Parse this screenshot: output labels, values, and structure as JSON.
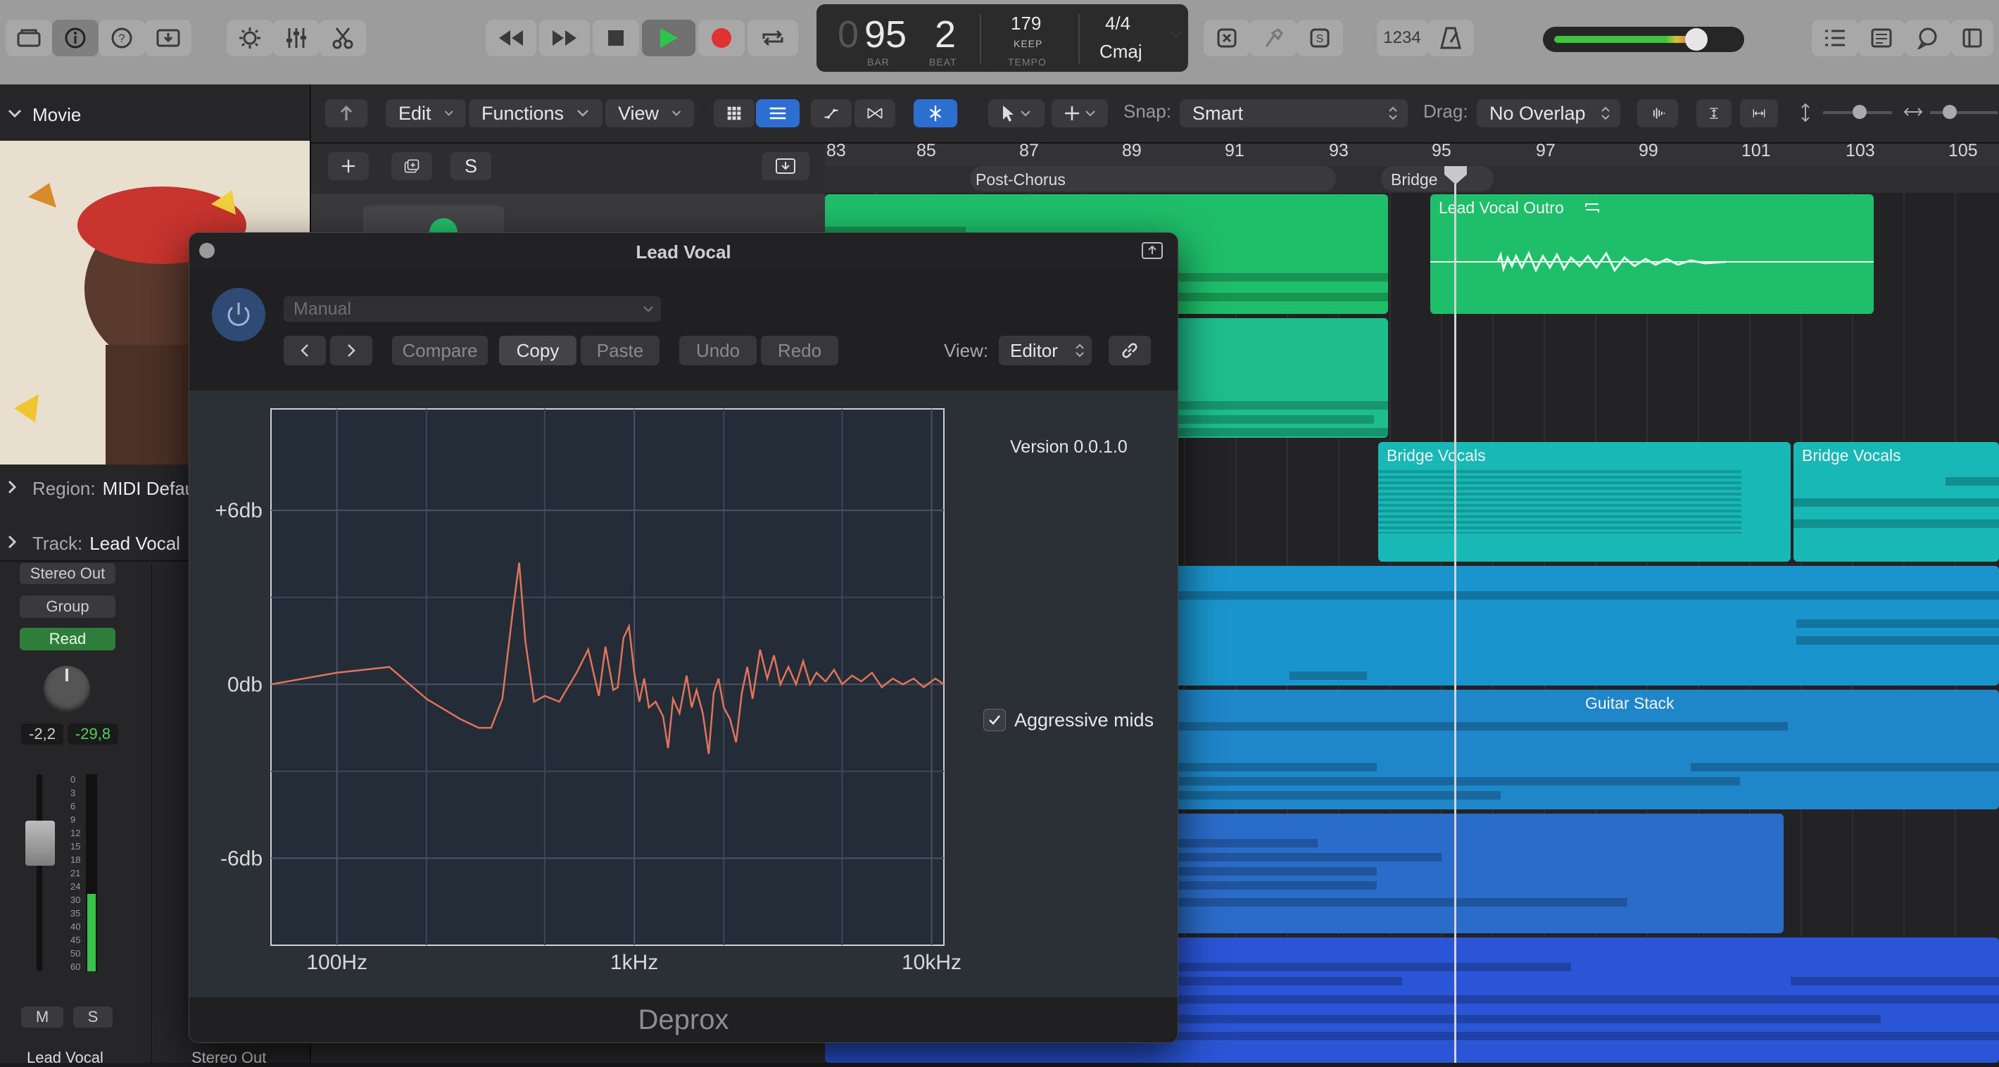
{
  "transport": {
    "bar": "95",
    "beat": "2",
    "bar_label": "BAR",
    "beat_label": "BEAT",
    "tempo": "179",
    "tempo_mode": "KEEP",
    "tempo_label": "TEMPO",
    "time_signature": "4/4",
    "key": "Cmaj",
    "counter_prefix": "0"
  },
  "toolbar": {
    "count_in": "1234",
    "volume_level": 0.78
  },
  "inspector": {
    "section_title": "Movie",
    "region_label": "Region:",
    "region_value": "MIDI Default",
    "track_label": "Track:",
    "track_value": "Lead Vocal",
    "output": "Stereo Out",
    "group": "Group",
    "automation": "Read",
    "volume_value": "-2,2",
    "peak_value": "-29,8",
    "mute": "M",
    "solo": "S",
    "channel_name": "Lead Vocal",
    "channel_name_2": "Stereo Out",
    "meter_scale": [
      "0",
      "3",
      "6",
      "9",
      "12",
      "15",
      "18",
      "21",
      "24",
      "30",
      "35",
      "40",
      "45",
      "50",
      "60"
    ]
  },
  "tracks_toolbar": {
    "edit": "Edit",
    "functions": "Functions",
    "view": "View",
    "snap_label": "Snap:",
    "snap_value": "Smart",
    "drag_label": "Drag:",
    "drag_value": "No Overlap",
    "s_button": "S"
  },
  "ruler": {
    "bars": [
      "83",
      "85",
      "87",
      "89",
      "91",
      "93",
      "95",
      "97",
      "99",
      "101",
      "103",
      "105"
    ],
    "markers": [
      {
        "label": "Post-Chorus"
      },
      {
        "label": "Bridge"
      }
    ]
  },
  "regions": [
    {
      "name": "Lead Vocal Outro",
      "color": "#1fbe6a"
    },
    {
      "name": "Bridge Vocals",
      "color": "#17b8b5"
    },
    {
      "name": "Bridge Vocals",
      "color": "#17b8b5"
    },
    {
      "name": "Guitar Stack",
      "color": "#1f86c9"
    }
  ],
  "plugin": {
    "window_title": "Lead Vocal",
    "preset": "Manual",
    "compare": "Compare",
    "copy": "Copy",
    "paste": "Paste",
    "undo": "Undo",
    "redo": "Redo",
    "view_label": "View:",
    "view_value": "Editor",
    "version": "Version 0.0.1.0",
    "aggressive_mids_label": "Aggressive mids",
    "aggressive_mids_checked": true,
    "footer_name": "Deprox",
    "curve_color": "#e0745a"
  },
  "chart_data": {
    "type": "line",
    "title": "",
    "xlabel": "",
    "ylabel": "",
    "x_scale": "log",
    "xlim": [
      60,
      11000
    ],
    "ylim": [
      -9,
      9.5
    ],
    "x_ticks": [
      {
        "value": 100,
        "label": "100Hz"
      },
      {
        "value": 1000,
        "label": "1kHz"
      },
      {
        "value": 10000,
        "label": "10kHz"
      }
    ],
    "y_ticks": [
      {
        "value": 6,
        "label": "+6db"
      },
      {
        "value": 0,
        "label": "0db"
      },
      {
        "value": -6,
        "label": "-6db"
      }
    ],
    "grid": true,
    "series": [
      {
        "points": [
          [
            60,
            0
          ],
          [
            100,
            0.4
          ],
          [
            150,
            0.6
          ],
          [
            200,
            -0.5
          ],
          [
            260,
            -1.2
          ],
          [
            300,
            -1.5
          ],
          [
            330,
            -1.5
          ],
          [
            360,
            -0.5
          ],
          [
            390,
            2.5
          ],
          [
            410,
            4.2
          ],
          [
            430,
            1.5
          ],
          [
            460,
            -0.6
          ],
          [
            500,
            -0.4
          ],
          [
            560,
            -0.6
          ],
          [
            640,
            0.4
          ],
          [
            700,
            1.2
          ],
          [
            760,
            -0.4
          ],
          [
            800,
            1.3
          ],
          [
            850,
            -0.2
          ],
          [
            880,
            -0.1
          ],
          [
            920,
            1.6
          ],
          [
            960,
            2.0
          ],
          [
            1000,
            0.4
          ],
          [
            1040,
            -0.6
          ],
          [
            1080,
            0.2
          ],
          [
            1120,
            -0.8
          ],
          [
            1180,
            -0.6
          ],
          [
            1250,
            -1.1
          ],
          [
            1300,
            -2.2
          ],
          [
            1350,
            -0.5
          ],
          [
            1420,
            -1.0
          ],
          [
            1500,
            0.3
          ],
          [
            1560,
            -0.8
          ],
          [
            1620,
            -0.2
          ],
          [
            1700,
            -1.0
          ],
          [
            1780,
            -2.4
          ],
          [
            1850,
            -0.3
          ],
          [
            1920,
            0.2
          ],
          [
            2000,
            -0.8
          ],
          [
            2100,
            -1.2
          ],
          [
            2200,
            -2.0
          ],
          [
            2300,
            -0.3
          ],
          [
            2400,
            0.6
          ],
          [
            2500,
            -0.5
          ],
          [
            2650,
            1.2
          ],
          [
            2800,
            0.2
          ],
          [
            2950,
            1.0
          ],
          [
            3100,
            0.0
          ],
          [
            3300,
            0.6
          ],
          [
            3500,
            0.0
          ],
          [
            3700,
            0.8
          ],
          [
            3900,
            0.0
          ],
          [
            4100,
            0.4
          ],
          [
            4400,
            0.1
          ],
          [
            4700,
            0.5
          ],
          [
            5000,
            0.0
          ],
          [
            5400,
            0.3
          ],
          [
            5800,
            0.1
          ],
          [
            6300,
            0.4
          ],
          [
            6800,
            -0.1
          ],
          [
            7400,
            0.2
          ],
          [
            8000,
            0.0
          ],
          [
            8700,
            0.2
          ],
          [
            9400,
            -0.1
          ],
          [
            10300,
            0.2
          ],
          [
            11000,
            0.0
          ]
        ]
      }
    ]
  }
}
